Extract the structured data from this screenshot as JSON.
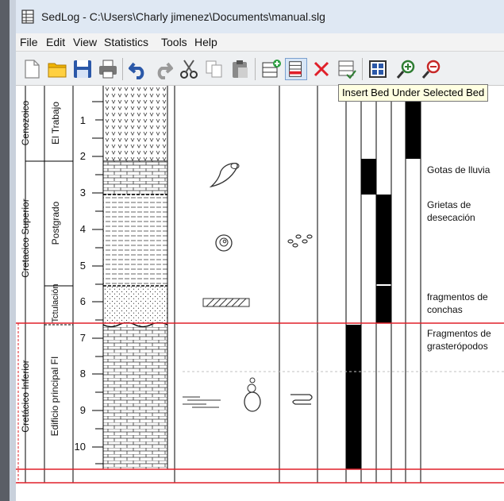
{
  "window": {
    "title": "SedLog - C:\\Users\\Charly jimenez\\Documents\\manual.slg"
  },
  "menu": [
    "File",
    "Edit",
    "View",
    "Statistics",
    "Tools",
    "Help"
  ],
  "toolbar": {
    "icons": [
      "new-file-icon",
      "open-folder-icon",
      "save-icon",
      "print-icon",
      "undo-icon",
      "redo-icon",
      "cut-icon",
      "copy-icon",
      "paste-icon",
      "insert-bed-above-icon",
      "insert-bed-below-icon",
      "delete-icon",
      "validate-icon",
      "grid-icon",
      "zoom-in-icon",
      "zoom-out-icon"
    ]
  },
  "tooltip": {
    "text": "Insert Bed Under Selected Bed"
  },
  "log": {
    "columns": {
      "era": [
        {
          "label": "Cenozoico"
        },
        {
          "label": "Cretacico Superior"
        },
        {
          "label": "Cretácico Inferior"
        }
      ],
      "formation": [
        {
          "label": "El Trabajo"
        },
        {
          "label": "Postgrado"
        },
        {
          "label": "Tctulación"
        },
        {
          "label": "Edificio principal FI"
        }
      ]
    },
    "depth_ticks": [
      "1",
      "2",
      "3",
      "4",
      "5",
      "6",
      "7",
      "8",
      "9",
      "10"
    ],
    "observations": [
      {
        "text": "Gotas de lluvia"
      },
      {
        "text": "Grietas de desecación"
      },
      {
        "text": "fragmentos de conchas"
      },
      {
        "text": "Fragmentos de grasterópodos"
      }
    ],
    "colors": {
      "accent_line": "#e0202a",
      "bar": "#000000",
      "grid": "#000000"
    }
  }
}
